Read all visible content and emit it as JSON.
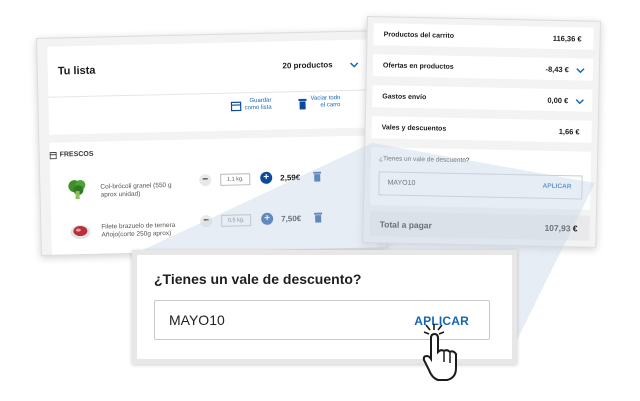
{
  "list": {
    "title": "Tu lista",
    "count": "20 productos",
    "save_label_1": "Guardar",
    "save_label_2": "como lista",
    "clear_label_1": "Vaciar todo",
    "clear_label_2": "el carro",
    "section": "FRESCOS",
    "products": [
      {
        "name_1": "Col-brócoli granel (550 g",
        "name_2": "aprox unidad)",
        "qty": "1,1 kg.",
        "price": "2,59€"
      },
      {
        "name_1": "Filete brazuelo de ternera",
        "name_2": "Añojo(corte 250g aprox)",
        "qty": "0,5 kg.",
        "price": "7,50€"
      }
    ]
  },
  "summary": {
    "rows": [
      {
        "label": "Productos del carrito",
        "value": "116,36 €"
      },
      {
        "label": "Ofertas en productos",
        "value": "-8,43 €"
      },
      {
        "label": "Gastos envío",
        "value": "0,00 €"
      },
      {
        "label": "Vales y descuentos",
        "value": "1,66 €"
      }
    ],
    "voucher_question": "¿Tienes un vale de descuento?",
    "voucher_code": "MAYO10",
    "apply_label": "APLICAR",
    "total_label": "Total a pagar",
    "total_value": "107,93 €"
  },
  "zoom": {
    "question": "¿Tienes un vale de descuento?",
    "code": "MAYO10",
    "apply_label": "APLICAR"
  },
  "colors": {
    "accent": "#1266b4",
    "brand_dark": "#0c4a9e",
    "panel_bg": "#f3f3f4"
  }
}
